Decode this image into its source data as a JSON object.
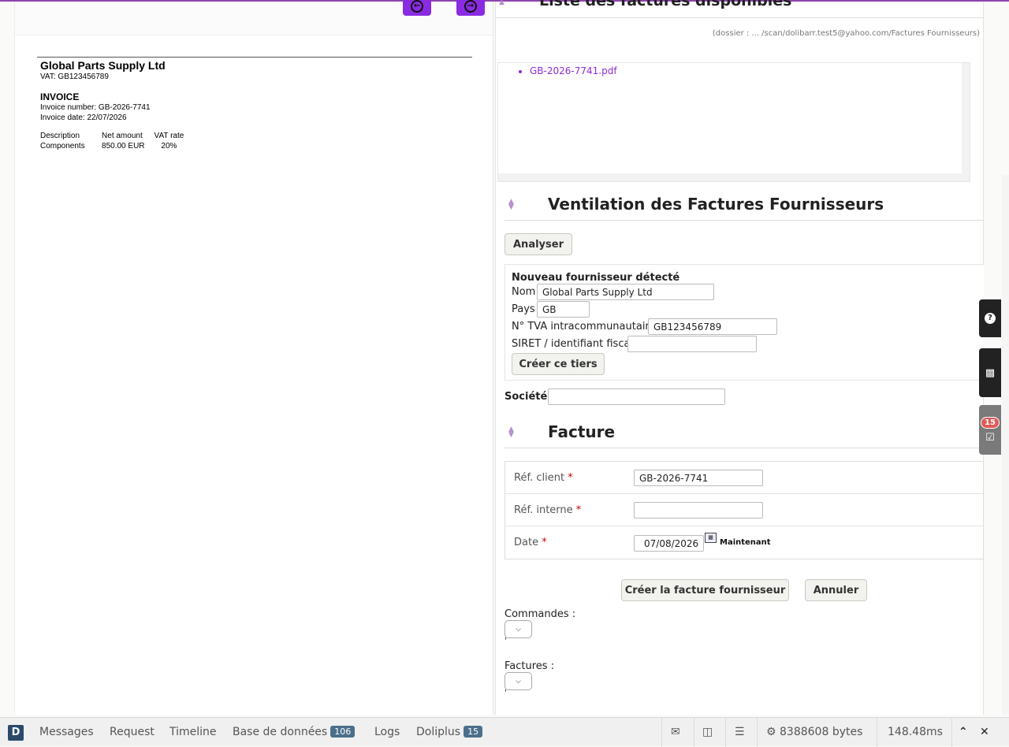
{
  "document": {
    "company": "Global Parts Supply Ltd",
    "vat": "VAT: GB123456789",
    "invoice_heading": "INVOICE",
    "invoice_number": "Invoice number: GB-2026-7741",
    "invoice_date": "Invoice date: 22/07/2026",
    "table": {
      "headers": [
        "Description",
        "Net amount",
        "VAT rate"
      ],
      "rows": [
        [
          "Components",
          "850.00 EUR",
          "20%"
        ]
      ]
    }
  },
  "liste": {
    "title": "Liste des factures disponibles",
    "dossier": "(dossier : ... /scan/dolibarr.test5@yahoo.com/Factures Fournisseurs)",
    "files": [
      "GB-2026-7741.pdf"
    ]
  },
  "ventilation": {
    "title": "Ventilation des Factures Fournisseurs",
    "analyse_button": "Analyser",
    "new_supplier": {
      "heading": "Nouveau fournisseur détecté",
      "nom_label": "Nom",
      "nom_value": "Global Parts Supply Ltd",
      "pays_label": "Pays",
      "pays_value": "GB",
      "tva_label": "N° TVA intracommunautaire",
      "tva_value": "GB123456789",
      "siret_label": "SIRET / identifiant fiscal",
      "siret_value": "",
      "create_button": "Créer ce tiers"
    },
    "societe_label": "Société",
    "societe_value": ""
  },
  "facture": {
    "title": "Facture",
    "ref_client_label": "Réf. client",
    "ref_client_value": "GB-2026-7741",
    "ref_interne_label": "Réf. interne",
    "ref_interne_value": "",
    "date_label": "Date",
    "date_value": "07/08/2026",
    "maintenant": "Maintenant",
    "required_mark": "*",
    "create_button": "Créer la facture fournisseur",
    "cancel_button": "Annuler",
    "commandes_label": "Commandes :",
    "factures_label": "Factures :",
    "tick": "'"
  },
  "sidebar": {
    "agenda_badge": "15"
  },
  "debugbar": {
    "messages": "Messages",
    "request": "Request",
    "timeline": "Timeline",
    "database": "Base de données",
    "database_count": "106",
    "logs": "Logs",
    "doliplus": "Doliplus",
    "doliplus_count": "15",
    "memory": "8388608 bytes",
    "time": "148.48ms"
  },
  "colors": {
    "accent": "#8a2be2",
    "link": "#8e2bd2"
  }
}
